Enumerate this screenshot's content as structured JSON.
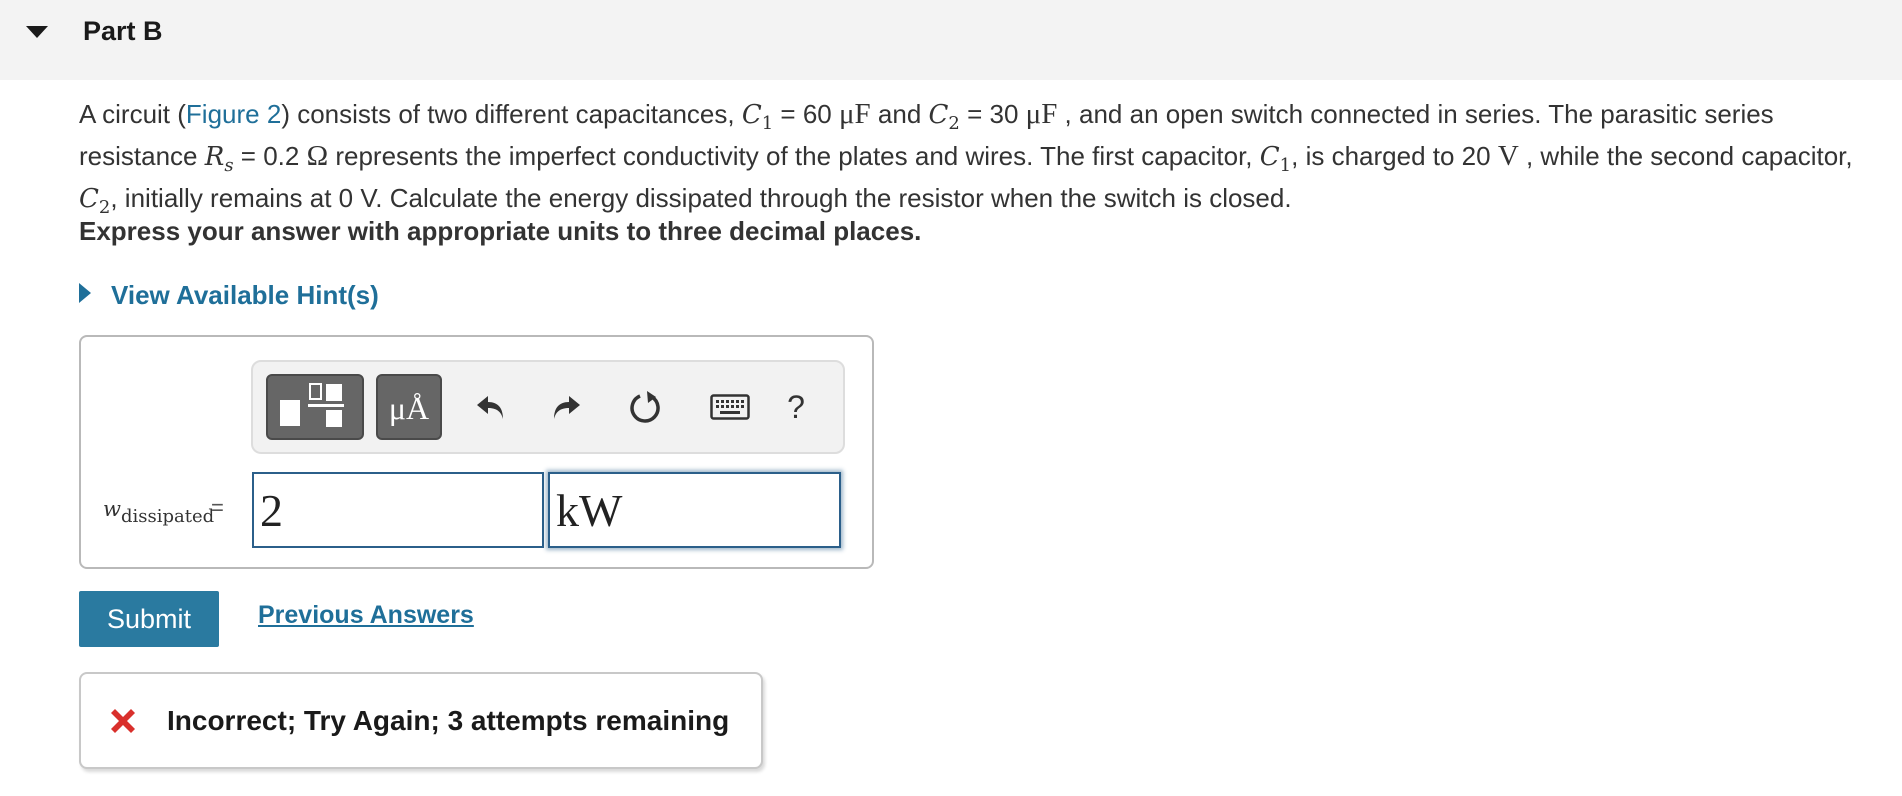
{
  "part": {
    "title": "Part B"
  },
  "question": {
    "line1": {
      "t1": "A circuit (",
      "figure_link": "Figure 2",
      "t2": ") consists of two different capacitances, ",
      "c1_sym": "C",
      "c1_sub": "1",
      "c1_eq": " = 60 ",
      "c1_unit": "μF",
      "t3": " and ",
      "c2_sym": "C",
      "c2_sub": "2",
      "c2_eq": " = 30 ",
      "c2_unit": "μF",
      "t4": " , and an open switch connected in series. The parasitic series"
    },
    "line2": {
      "t1": "resistance ",
      "r_sym": "R",
      "r_sub": "s",
      "r_eq": " = 0.2 ",
      "r_unit": "Ω",
      "t2": " represents the imperfect conductivity of the plates and wires. The first capacitor, ",
      "c1_sym": "C",
      "c1_sub": "1",
      "t3": ", is charged to 20 ",
      "v_unit": "V",
      "t4": " , while the second capacitor,"
    },
    "line3": {
      "c2_sym": "C",
      "c2_sub": "2",
      "t1": ", initially remains at 0 V. Calculate the energy dissipated through the resistor when the switch is closed."
    }
  },
  "instruction": "Express your answer with appropriate units to three decimal places.",
  "hints": {
    "label": "View Available Hint(s)"
  },
  "toolbar": {
    "units_label": "μÅ",
    "help_label": "?",
    "icons": [
      "templates-icon",
      "units-icon",
      "undo-icon",
      "redo-icon",
      "reset-icon",
      "keyboard-icon",
      "help-icon"
    ]
  },
  "answer": {
    "variable": "w",
    "variable_sub": "dissipated",
    "equals": "=",
    "value": "2",
    "unit": "kW"
  },
  "actions": {
    "submit_label": "Submit",
    "previous_answers_label": "Previous Answers"
  },
  "feedback": {
    "message": "Incorrect; Try Again; 3 attempts remaining",
    "status_color": "#d9302c"
  },
  "colors": {
    "link": "#1f6f99",
    "submit_bg": "#2a7aa0",
    "header_bg": "#f3f3f3"
  }
}
